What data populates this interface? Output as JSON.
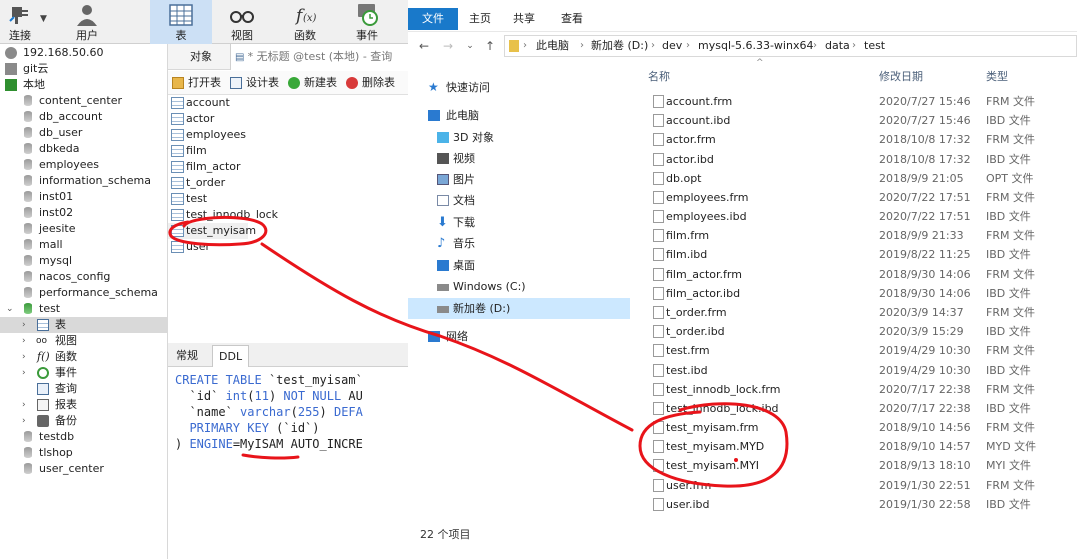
{
  "navicat": {
    "toolbar": [
      {
        "label": "连接",
        "icon": "plug-icon"
      },
      {
        "label": "用户",
        "icon": "user-icon"
      },
      {
        "label": "表",
        "icon": "table-icon"
      },
      {
        "label": "视图",
        "icon": "glasses-icon"
      },
      {
        "label": "函数",
        "icon": "function-icon"
      },
      {
        "label": "事件",
        "icon": "clock-icon"
      }
    ],
    "tree": [
      {
        "label": "192.168.50.60",
        "type": "conn"
      },
      {
        "label": "git云",
        "type": "conn"
      },
      {
        "label": "本地",
        "type": "conn-open"
      },
      {
        "label": "content_center",
        "type": "db"
      },
      {
        "label": "db_account",
        "type": "db"
      },
      {
        "label": "db_user",
        "type": "db"
      },
      {
        "label": "dbkeda",
        "type": "db"
      },
      {
        "label": "employees",
        "type": "db"
      },
      {
        "label": "information_schema",
        "type": "db"
      },
      {
        "label": "inst01",
        "type": "db"
      },
      {
        "label": "inst02",
        "type": "db"
      },
      {
        "label": "jeesite",
        "type": "db"
      },
      {
        "label": "mall",
        "type": "db"
      },
      {
        "label": "mysql",
        "type": "db"
      },
      {
        "label": "nacos_config",
        "type": "db"
      },
      {
        "label": "performance_schema",
        "type": "db"
      },
      {
        "label": "test",
        "type": "db-open"
      },
      {
        "label": "表",
        "type": "tables"
      },
      {
        "label": "视图",
        "type": "views"
      },
      {
        "label": "函数",
        "type": "funcs"
      },
      {
        "label": "事件",
        "type": "events"
      },
      {
        "label": "查询",
        "type": "queries"
      },
      {
        "label": "报表",
        "type": "reports"
      },
      {
        "label": "备份",
        "type": "backup"
      },
      {
        "label": "testdb",
        "type": "db"
      },
      {
        "label": "tlshop",
        "type": "db"
      },
      {
        "label": "user_center",
        "type": "db"
      }
    ],
    "tabs": {
      "objects": "对象",
      "query": "* 无标题 @test (本地) - 查询"
    },
    "object_toolbar": {
      "open": "打开表",
      "design": "设计表",
      "new": "新建表",
      "delete": "删除表"
    },
    "tables": [
      "account",
      "actor",
      "employees",
      "film",
      "film_actor",
      "t_order",
      "test",
      "test_innodb_lock",
      "test_myisam",
      "user"
    ],
    "ddl_tabs": {
      "general": "常规",
      "ddl": "DDL"
    },
    "ddl": [
      "CREATE TABLE `test_myisam`",
      "  `id` int(11) NOT NULL AU",
      "  `name` varchar(255) DEFA",
      "  PRIMARY KEY (`id`)",
      ") ENGINE=MyISAM AUTO_INCRE"
    ]
  },
  "explorer": {
    "ribbon": {
      "file": "文件",
      "home": "主页",
      "share": "共享",
      "view": "查看"
    },
    "path": [
      "此电脑",
      "新加卷 (D:)",
      "dev",
      "mysql-5.6.33-winx64",
      "data",
      "test"
    ],
    "sidenav": [
      {
        "label": "快速访问",
        "icon": "star-icon"
      },
      {
        "label": "此电脑",
        "icon": "pc-icon"
      },
      {
        "label": "3D 对象",
        "icon": "cube-icon"
      },
      {
        "label": "视频",
        "icon": "video-icon"
      },
      {
        "label": "图片",
        "icon": "picture-icon"
      },
      {
        "label": "文档",
        "icon": "document-icon"
      },
      {
        "label": "下载",
        "icon": "download-icon"
      },
      {
        "label": "音乐",
        "icon": "music-icon"
      },
      {
        "label": "桌面",
        "icon": "desktop-icon"
      },
      {
        "label": "Windows (C:)",
        "icon": "drive-icon"
      },
      {
        "label": "新加卷 (D:)",
        "icon": "drive-icon"
      },
      {
        "label": "网络",
        "icon": "network-icon"
      }
    ],
    "columns": {
      "name": "名称",
      "date": "修改日期",
      "type": "类型"
    },
    "files": [
      {
        "name": "account.frm",
        "date": "2020/7/27 15:46",
        "type": "FRM 文件"
      },
      {
        "name": "account.ibd",
        "date": "2020/7/27 15:46",
        "type": "IBD 文件"
      },
      {
        "name": "actor.frm",
        "date": "2018/10/8 17:32",
        "type": "FRM 文件"
      },
      {
        "name": "actor.ibd",
        "date": "2018/10/8 17:32",
        "type": "IBD 文件"
      },
      {
        "name": "db.opt",
        "date": "2018/9/9 21:05",
        "type": "OPT 文件"
      },
      {
        "name": "employees.frm",
        "date": "2020/7/22 17:51",
        "type": "FRM 文件"
      },
      {
        "name": "employees.ibd",
        "date": "2020/7/22 17:51",
        "type": "IBD 文件"
      },
      {
        "name": "film.frm",
        "date": "2018/9/9 21:33",
        "type": "FRM 文件"
      },
      {
        "name": "film.ibd",
        "date": "2019/8/22 11:25",
        "type": "IBD 文件"
      },
      {
        "name": "film_actor.frm",
        "date": "2018/9/30 14:06",
        "type": "FRM 文件"
      },
      {
        "name": "film_actor.ibd",
        "date": "2018/9/30 14:06",
        "type": "IBD 文件"
      },
      {
        "name": "t_order.frm",
        "date": "2020/3/9 14:37",
        "type": "FRM 文件"
      },
      {
        "name": "t_order.ibd",
        "date": "2020/3/9 15:29",
        "type": "IBD 文件"
      },
      {
        "name": "test.frm",
        "date": "2019/4/29 10:30",
        "type": "FRM 文件"
      },
      {
        "name": "test.ibd",
        "date": "2019/4/29 10:30",
        "type": "IBD 文件"
      },
      {
        "name": "test_innodb_lock.frm",
        "date": "2020/7/17 22:38",
        "type": "FRM 文件"
      },
      {
        "name": "test_innodb_lock.ibd",
        "date": "2020/7/17 22:38",
        "type": "IBD 文件"
      },
      {
        "name": "test_myisam.frm",
        "date": "2018/9/10 14:56",
        "type": "FRM 文件"
      },
      {
        "name": "test_myisam.MYD",
        "date": "2018/9/10 14:57",
        "type": "MYD 文件"
      },
      {
        "name": "test_myisam.MYI",
        "date": "2018/9/13 18:10",
        "type": "MYI 文件"
      },
      {
        "name": "user.frm",
        "date": "2019/1/30 22:51",
        "type": "FRM 文件"
      },
      {
        "name": "user.ibd",
        "date": "2019/1/30 22:58",
        "type": "IBD 文件"
      }
    ],
    "status": "22 个项目"
  },
  "colors": {
    "accent": "#1979ca",
    "annotation": "#e8141a",
    "selected": "#cce8ff"
  }
}
